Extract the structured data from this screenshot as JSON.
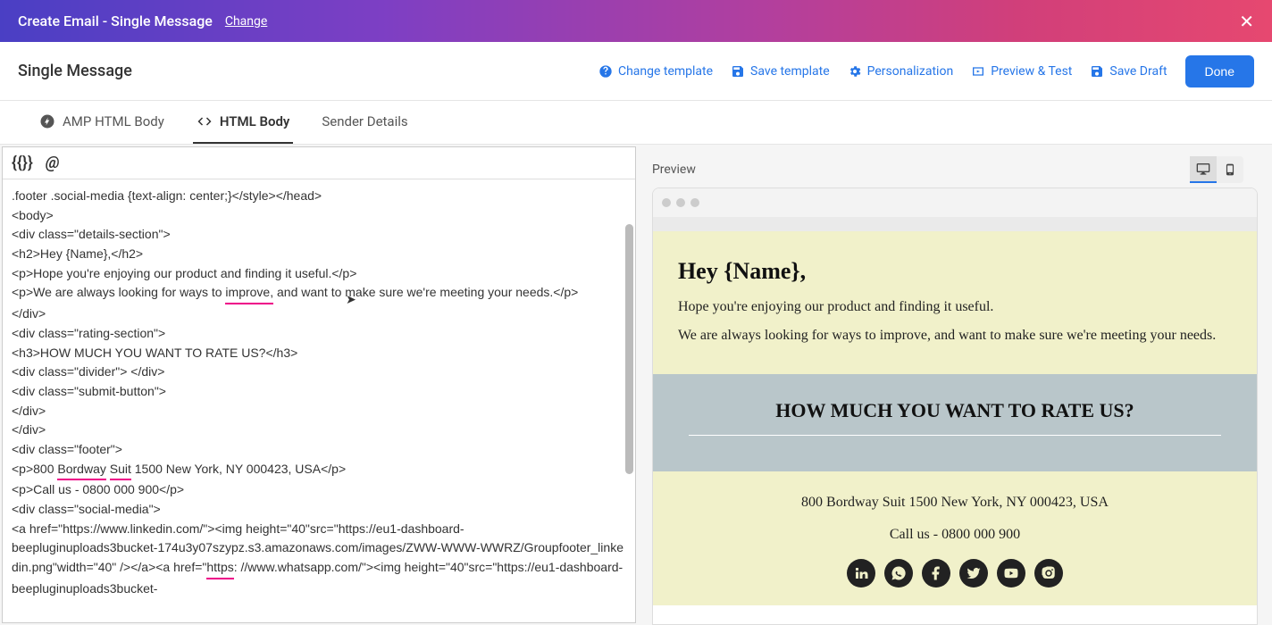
{
  "banner": {
    "title": "Create Email - Single Message",
    "change": "Change"
  },
  "toolbar": {
    "title": "Single Message",
    "changeTemplate": "Change template",
    "saveTemplate": "Save template",
    "personalization": "Personalization",
    "previewTest": "Preview & Test",
    "saveDraft": "Save Draft",
    "done": "Done"
  },
  "tabs": {
    "amp": "AMP HTML Body",
    "html": "HTML Body",
    "sender": "Sender Details"
  },
  "editorIcons": {
    "braces": "{{}}",
    "at": "@"
  },
  "code": {
    "l1": ".footer .social-media {text-align: center;}</style></head>",
    "l2": "<body>",
    "l3": "<div class=\"details-section\">",
    "l4": "<h2>Hey {Name},</h2>",
    "l5": "<p>Hope you're enjoying our product and finding it useful.</p>",
    "l6a": "<p>We are always looking for ways to ",
    "l6sp": "improve,",
    "l6b": " and want to make sure we're meeting your needs.</p>",
    "l7": "</div>",
    "l8": "<div class=\"rating-section\">",
    "l9": "<h3>HOW MUCH YOU WANT TO RATE US?</h3>",
    "l10": "<div class=\"divider\"> </div>",
    "l11": "<div class=\"submit-button\">",
    "l12": "",
    "l13": "</div>",
    "l14": "</div>",
    "l15": "<div class=\"footer\">",
    "l16a": "<p>800 ",
    "l16sp1": "Bordway",
    "l16mid": " ",
    "l16sp2": "Suit",
    "l16b": " 1500 New York, NY 000423, USA</p>",
    "l17": "<p>Call us - 0800 000 900</p>",
    "l18": "<div class=\"social-media\">",
    "l19": "<a href=\"https://www.linkedin.com/\"><img height=\"40\"src=\"https://eu1-dashboard-",
    "l20a": "beepluginuploads3bucket-174u3y07szypz.s3.amazonaws.com/images/ZWW-WWW-WWRZ/Groupfooter_linkedin.png\"width=\"40\" /></a><a href=\"",
    "l20sp": "https",
    "l20b": ": //www.whatsapp.com/\"><img height=\"40\"src=\"https://eu1-dashboard-beepluginuploads3bucket-"
  },
  "preview": {
    "label": "Preview",
    "heading": "Hey {Name},",
    "p1": "Hope you're enjoying our product and finding it useful.",
    "p2": "We are always looking for ways to improve, and want to make sure we're meeting your needs.",
    "rate": "HOW MUCH YOU WANT TO RATE US?",
    "addr": "800 Bordway Suit 1500 New York, NY 000423, USA",
    "phone": "Call us - 0800 000 900"
  }
}
